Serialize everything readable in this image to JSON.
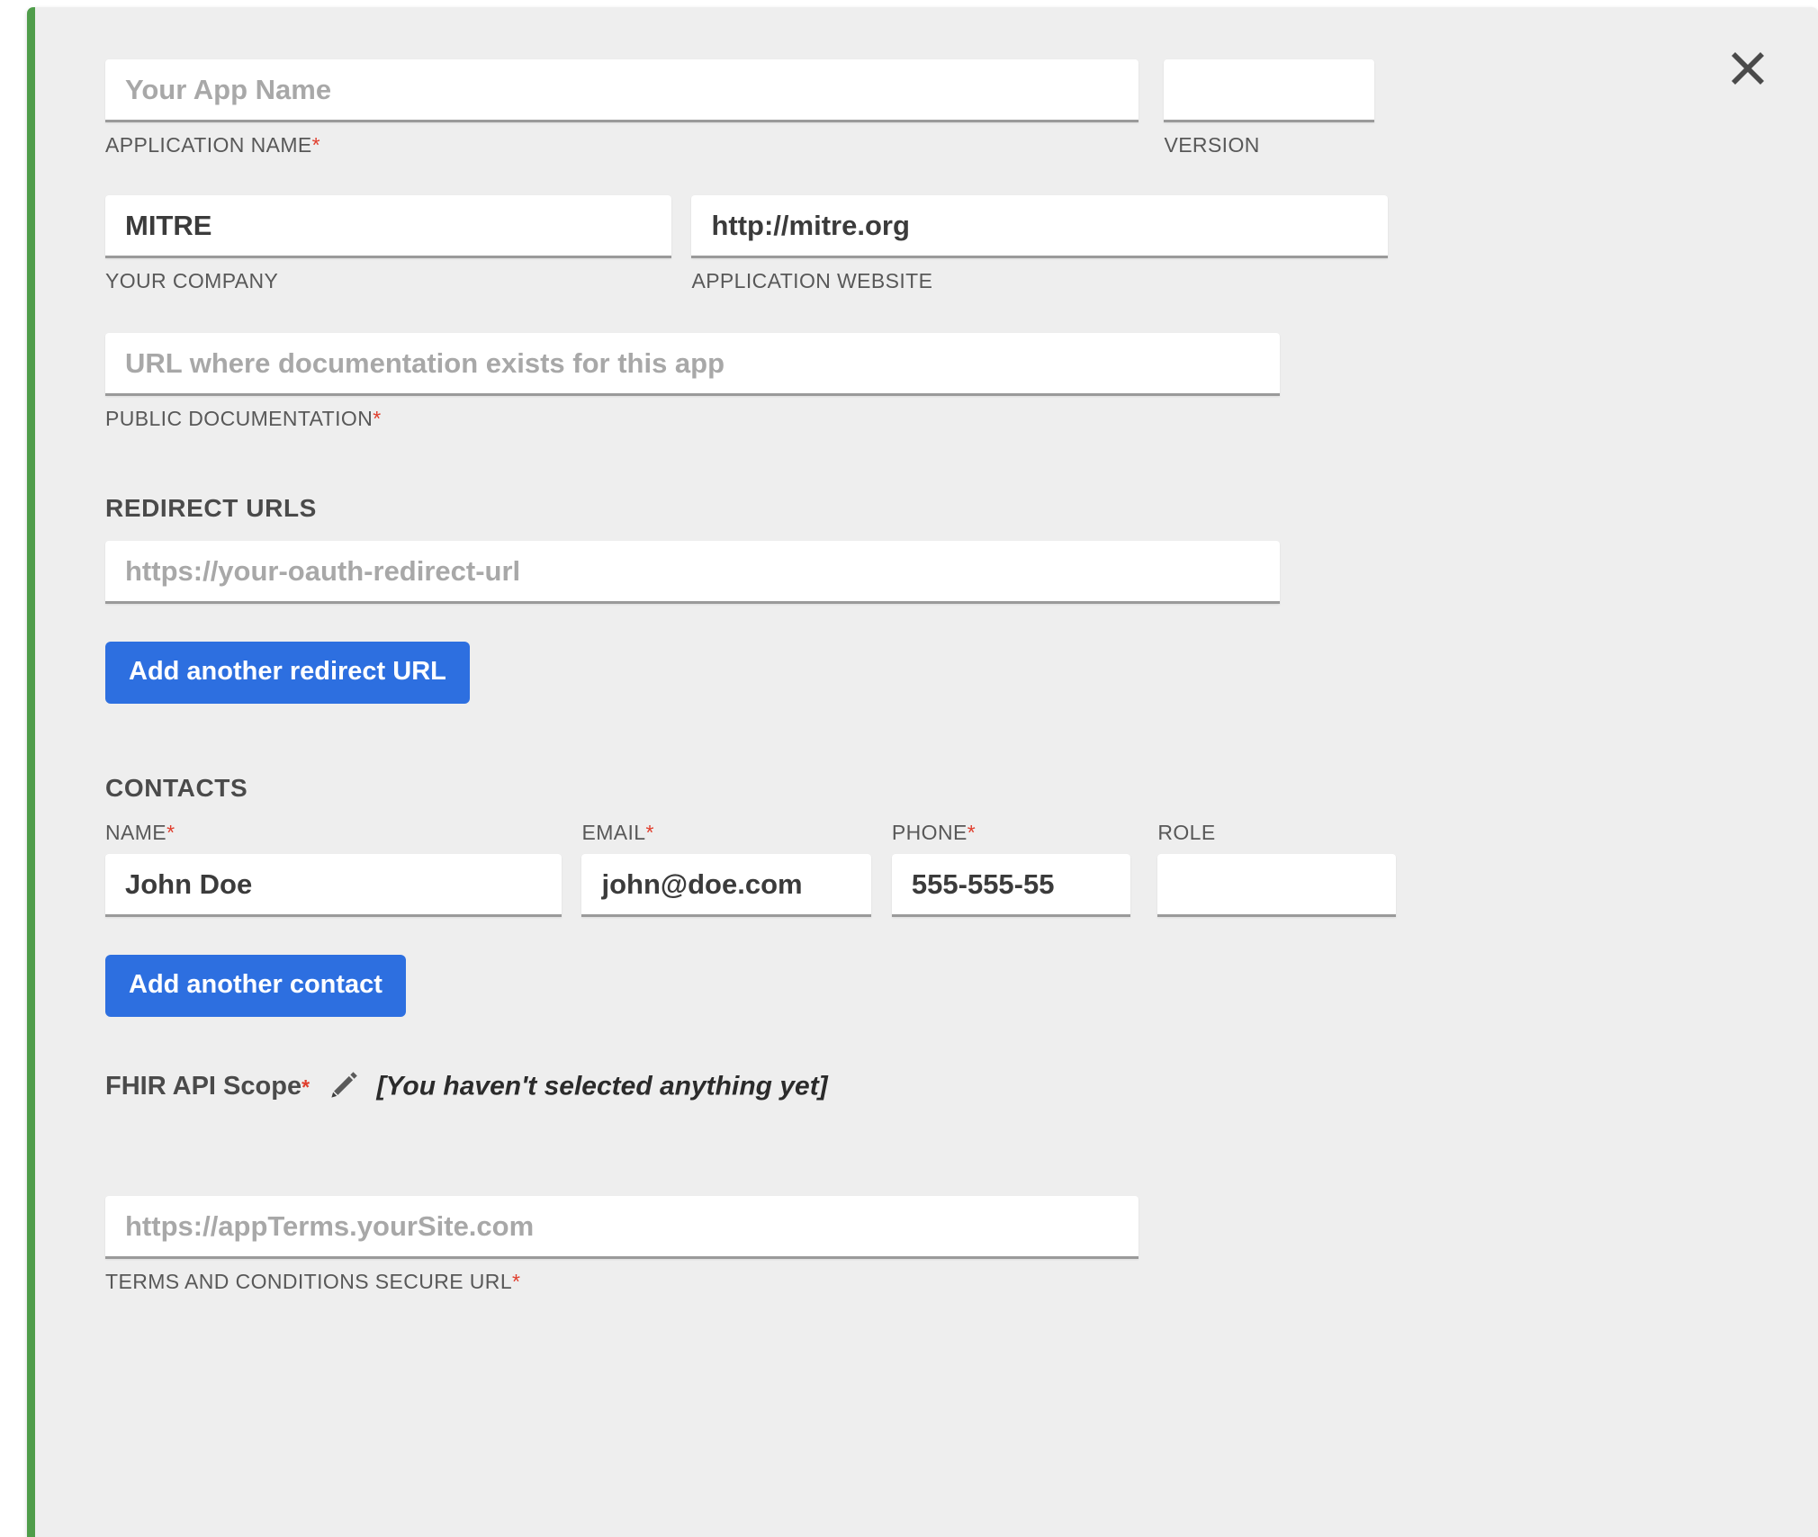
{
  "window": {
    "accent_bar_color": "#4f9d4a",
    "panel_bg": "#eeeeee",
    "close_icon": "close-icon"
  },
  "form": {
    "app_name": {
      "label": "APPLICATION NAME",
      "required": "*",
      "value": "",
      "placeholder": "Your App Name"
    },
    "version": {
      "label": "VERSION",
      "required": "",
      "value": "",
      "placeholder": ""
    },
    "company": {
      "label": "YOUR COMPANY",
      "required": "",
      "value": "MITRE",
      "placeholder": ""
    },
    "website": {
      "label": "APPLICATION WEBSITE",
      "required": "",
      "value": "http://mitre.org",
      "placeholder": ""
    },
    "documentation": {
      "label": "PUBLIC DOCUMENTATION",
      "required": "*",
      "value": "",
      "placeholder": "URL where documentation exists for this app"
    },
    "redirect_section": {
      "heading": "REDIRECT URLS",
      "url": {
        "value": "",
        "placeholder": "https://your-oauth-redirect-url"
      },
      "add_button": "Add another redirect URL"
    },
    "contacts_section": {
      "heading": "CONTACTS",
      "columns": [
        {
          "label": "NAME",
          "required": "*"
        },
        {
          "label": "EMAIL",
          "required": "*"
        },
        {
          "label": "PHONE",
          "required": "*"
        },
        {
          "label": "ROLE",
          "required": ""
        }
      ],
      "rows": [
        {
          "name": "John Doe",
          "email": "john@doe.com",
          "phone": "555-555-55",
          "role": ""
        }
      ],
      "add_button": "Add another contact"
    },
    "fhir_scope": {
      "label": "FHIR API Scope",
      "required": "*",
      "edit_icon": "pencil-icon",
      "value": "[You haven't selected anything yet]"
    },
    "terms": {
      "label": "TERMS AND CONDITIONS SECURE URL",
      "required": "*",
      "value": "",
      "placeholder": "https://appTerms.yourSite.com"
    }
  },
  "colors": {
    "primary_button": "#2d6fe0",
    "required_marker": "#e03e2d",
    "accent_bar": "#4f9d4a",
    "label_text": "#585858",
    "input_underline": "#9a9a9a"
  }
}
